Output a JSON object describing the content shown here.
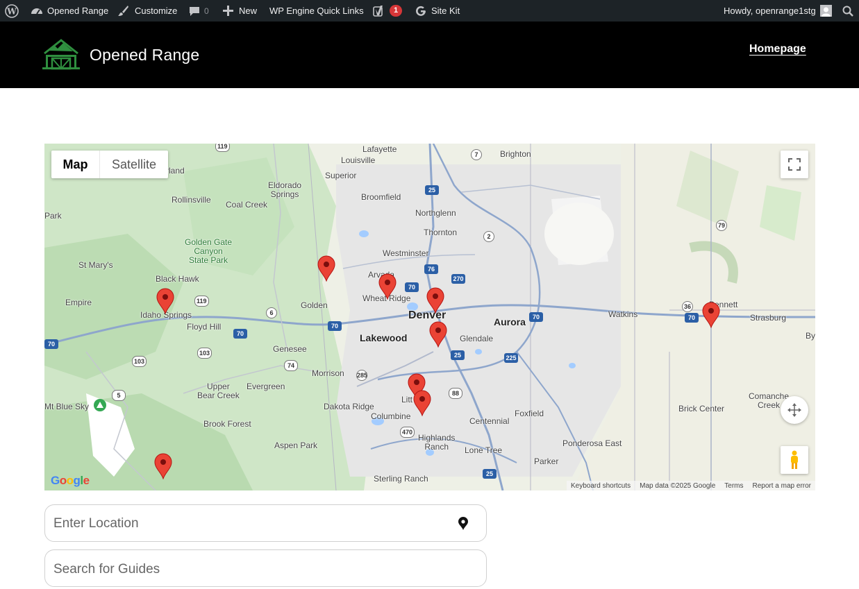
{
  "adminbar": {
    "wp_icon": "wordpress-logo-icon",
    "site_name": "Opened Range",
    "customize": "Customize",
    "comments_count": "0",
    "new": "New",
    "quick_links": "WP Engine Quick Links",
    "yoast_badge": "1",
    "site_kit": "Site Kit",
    "howdy": "Howdy, openrange1stg"
  },
  "header": {
    "site_title": "Opened Range",
    "nav": [
      {
        "label": "Homepage"
      }
    ]
  },
  "map": {
    "type_map": "Map",
    "type_satellite": "Satellite",
    "logo": "Google",
    "attribution": {
      "shortcuts": "Keyboard shortcuts",
      "data": "Map data ©2025 Google",
      "terms": "Terms",
      "report": "Report a map error"
    },
    "places": {
      "lafayette": "Lafayette",
      "brighton": "Brighton",
      "louisville": "Louisville",
      "superior": "Superior",
      "eldorado": "Eldorado\nSprings",
      "broomfield": "Broomfield",
      "northglenn": "Northglenn",
      "thornton": "Thornton",
      "rollinsville": "Rollinsville",
      "coal_creek": "Coal Creek",
      "golden_gate": "Golden Gate\nCanyon\nState Park",
      "westminster": "Westminster",
      "arvada": "Arvada",
      "st_marys": "St Mary's",
      "black_hawk": "Black Hawk",
      "wheat_ridge": "Wheat Ridge",
      "golden": "Golden",
      "empire": "Empire",
      "idaho_springs": "Idaho Springs",
      "floyd_hill": "Floyd Hill",
      "denver": "Denver",
      "aurora": "Aurora",
      "watkins": "Watkins",
      "bennett": "Bennett",
      "strasburg": "Strasburg",
      "lakewood": "Lakewood",
      "glendale": "Glendale",
      "genesee": "Genesee",
      "morrison": "Morrison",
      "upper_bear_creek": "Upper\nBear Creek",
      "evergreen": "Evergreen",
      "dakota_ridge": "Dakota Ridge",
      "littleton": "Litt",
      "columbine": "Columbine",
      "centennial": "Centennial",
      "foxfield": "Foxfield",
      "comanche_creek": "Comanche\nCreek",
      "brick_center": "Brick Center",
      "mt_blue_sky": "Mt Blue Sky",
      "brook_forest": "Brook Forest",
      "aspen_park": "Aspen Park",
      "highlands_ranch": "Highlands\nRanch",
      "lone_tree": "Lone Tree",
      "ponderosa_east": "Ponderosa East",
      "parker": "Parker",
      "sterling_ranch": "Sterling Ranch",
      "nederland_part": "rland",
      "park_part": "Park",
      "by_part": "By"
    },
    "routes": [
      "119",
      "7",
      "25",
      "2",
      "79",
      "76",
      "270",
      "70",
      "6",
      "36",
      "70",
      "70",
      "225",
      "25",
      "285",
      "88",
      "103",
      "5",
      "74",
      "470",
      "25",
      "70"
    ]
  },
  "form": {
    "location_placeholder": "Enter Location",
    "guides_placeholder": "Search for Guides"
  }
}
